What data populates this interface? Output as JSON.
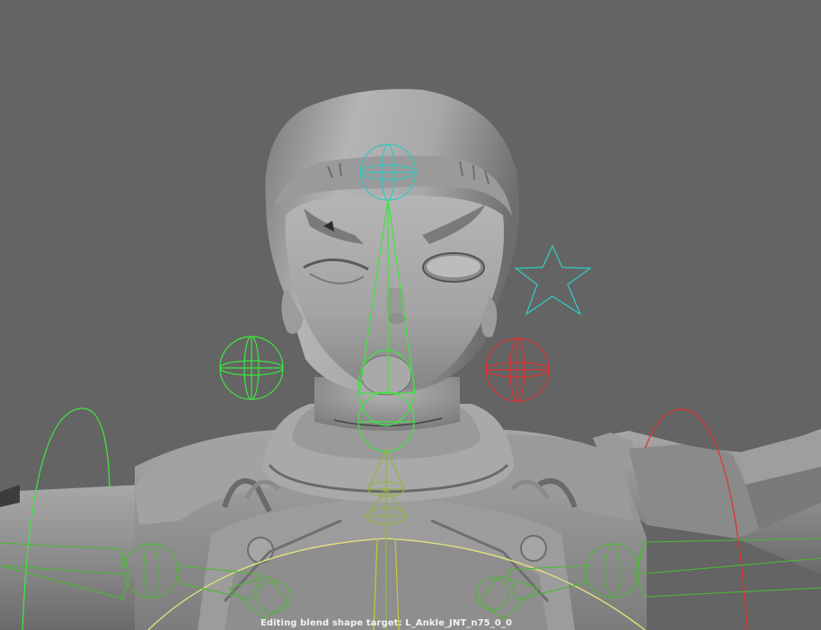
{
  "viewport": {
    "background": "#646464",
    "status_text": "Editing blend shape target: L_Ankle_JNT_n75_0_0"
  },
  "colors": {
    "mesh_light": "#b9b9b9",
    "mesh_mid": "#8e8e8e",
    "mesh_dark": "#4c4c4c",
    "control_green": "#3ee63e",
    "control_red": "#e03232",
    "control_cyan": "#35c7bf",
    "control_yellow": "#e6e67a",
    "bone_green": "#4bb832",
    "bone_yellow": "#c8c832",
    "status_text": "#f2f2f2"
  }
}
